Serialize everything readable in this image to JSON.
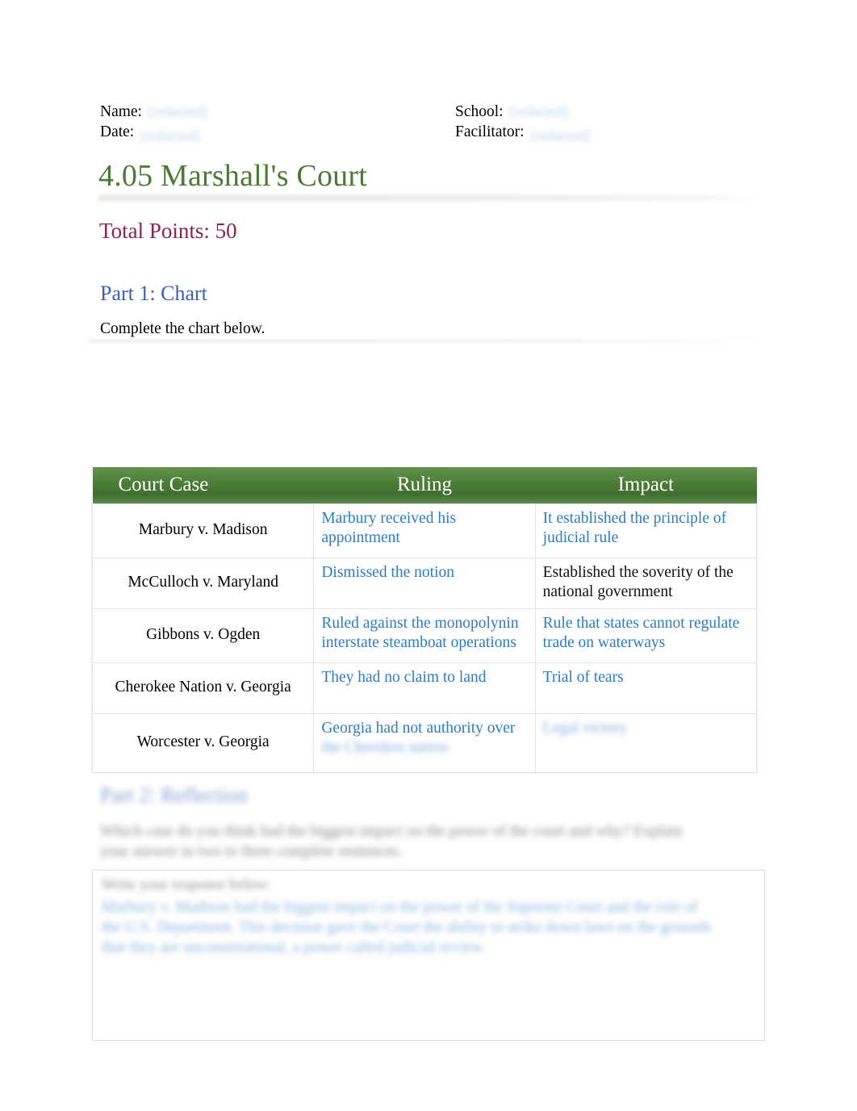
{
  "header": {
    "name_label": "Name:",
    "name_value": "[redacted]",
    "date_label": "Date:",
    "date_value": "[redacted]",
    "school_label": "School:",
    "school_value": "[redacted]",
    "facilitator_label": "Facilitator:",
    "facilitator_value": "[redacted]"
  },
  "title": "4.05 Marshall's Court",
  "total_points": "Total Points: 50",
  "part1": {
    "heading": "Part 1: Chart",
    "instruction": "Complete the chart below."
  },
  "chart_data": {
    "type": "table",
    "title": "Part 1: Chart",
    "columns": [
      "Court Case",
      "Ruling",
      "Impact"
    ],
    "rows": [
      {
        "case": "Marbury v. Madison",
        "ruling": "Marbury received his appointment",
        "ruling_style": "blue",
        "impact": "It established the principle of judicial rule",
        "impact_style": "blue"
      },
      {
        "case": "McCulloch v. Maryland",
        "ruling": "Dismissed the notion",
        "ruling_style": "blue",
        "impact": "Established the soverity of the national government",
        "impact_style": "black"
      },
      {
        "case": "Gibbons v. Ogden",
        "ruling": "Ruled against the monopolynin interstate steamboat operations",
        "ruling_style": "blue",
        "impact": "Rule that states cannot regulate trade on waterways",
        "impact_style": "blue"
      },
      {
        "case": "Cherokee Nation v. Georgia",
        "ruling": "They had no claim to land",
        "ruling_style": "blue",
        "impact": "Trial of tears",
        "impact_style": "blue"
      },
      {
        "case": "Worcester v. Georgia",
        "ruling": "Georgia had not authority over",
        "ruling_style": "blue",
        "ruling_blurred": "the Cherokee nation",
        "impact": "",
        "impact_style": "blue",
        "impact_blurred": "Legal victory"
      }
    ]
  },
  "part2": {
    "heading": "Part 2: Reflection",
    "question": "Which case do you think had the biggest impact on the power of the court and why? Explain your answer in two to three complete sentences.",
    "answer_prompt": "Write your response below:",
    "answer_text": "Marbury v. Madison had the biggest impact on the power of the Supreme Court and the role of the U.S. Department. This decision gave the Court the ability to strike down laws on the grounds that they are unconstitutional, a power called judicial review."
  },
  "colors": {
    "title_green": "#4a7a34",
    "points_maroon": "#8c2352",
    "heading_blue": "#3b62b5",
    "answer_blue": "#2b7cc6",
    "table_header_green": "#4e8039"
  }
}
